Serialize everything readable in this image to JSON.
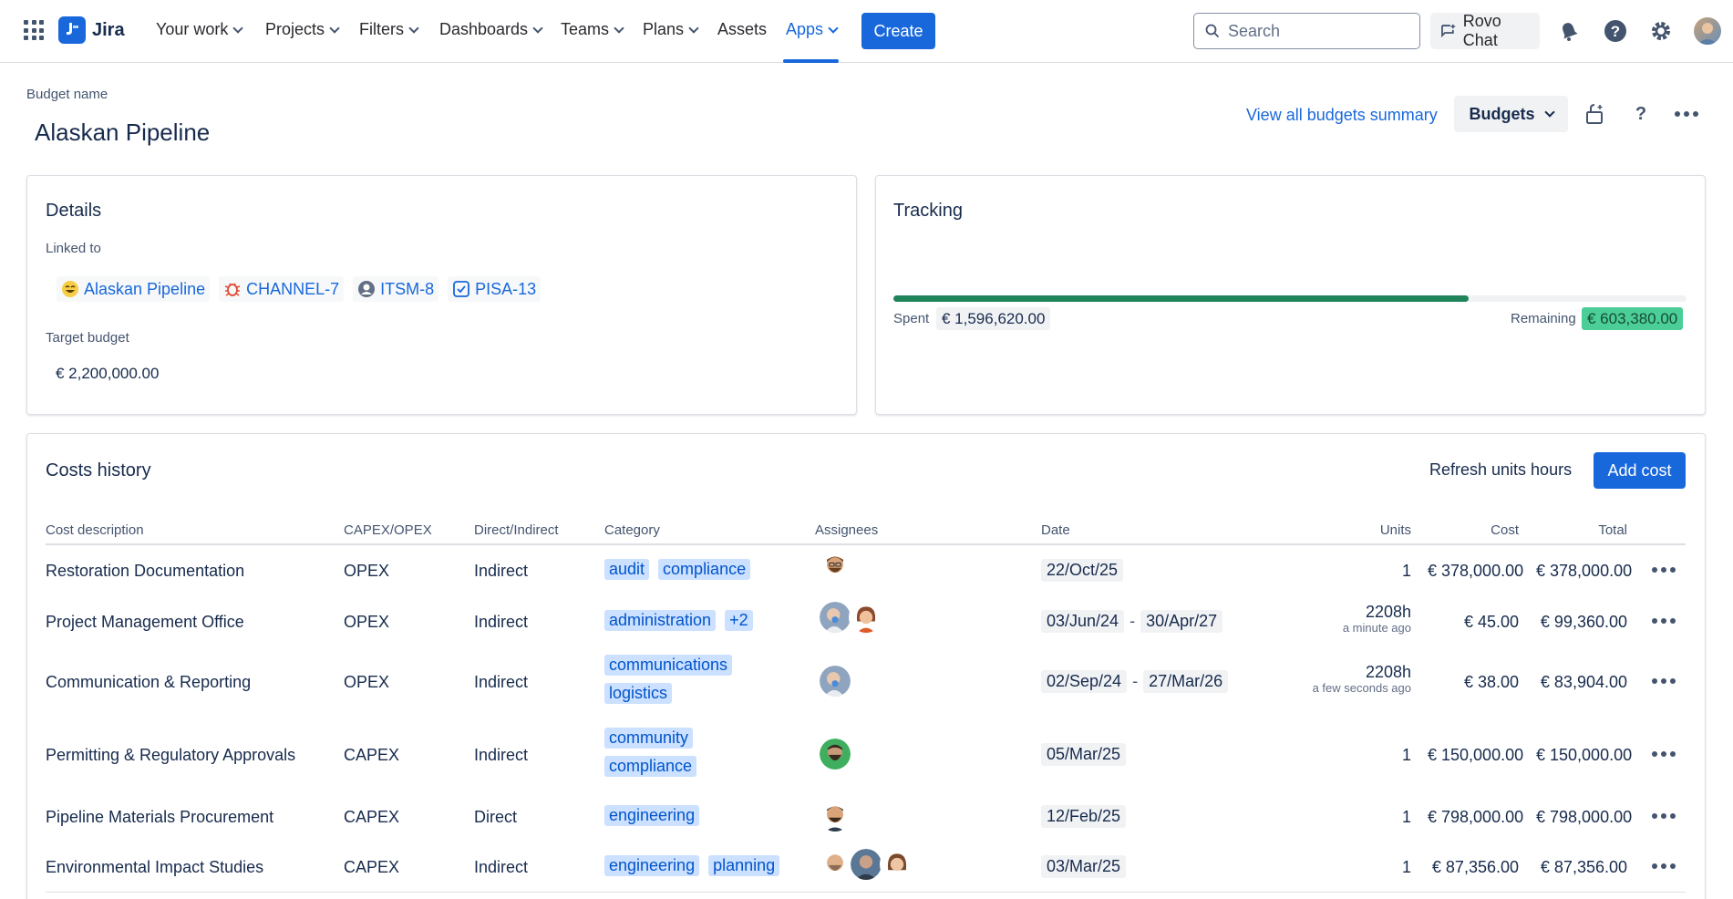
{
  "nav": {
    "logo": "Jira",
    "items": [
      "Your work",
      "Projects",
      "Filters",
      "Dashboards",
      "Teams",
      "Plans",
      "Assets",
      "Apps"
    ],
    "create": "Create",
    "search_placeholder": "Search",
    "rovo": "Rovo Chat",
    "accent": "#1868db"
  },
  "header": {
    "budget_label": "Budget name",
    "budget_name": "Alaskan Pipeline",
    "view_all": "View all budgets summary",
    "budgets_btn": "Budgets",
    "help": "?"
  },
  "details": {
    "title": "Details",
    "linked_label": "Linked to",
    "linked": [
      {
        "icon": "emoji-face-icon",
        "label": "Alaskan Pipeline"
      },
      {
        "icon": "bug-icon",
        "label": "CHANNEL-7"
      },
      {
        "icon": "person-icon",
        "label": "ITSM-8"
      },
      {
        "icon": "checkbox-icon",
        "label": "PISA-13"
      }
    ],
    "target_label": "Target budget",
    "target_value": "€  2,200,000.00"
  },
  "tracking": {
    "title": "Tracking",
    "spent_label": "Spent",
    "spent_value": "€ 1,596,620.00",
    "remaining_label": "Remaining",
    "remaining_value": "€ 603,380.00",
    "spent_fraction": 0.7257
  },
  "costs": {
    "title": "Costs history",
    "refresh": "Refresh units hours",
    "add": "Add cost",
    "headers": {
      "desc": "Cost description",
      "capex": "CAPEX/OPEX",
      "direct": "Direct/Indirect",
      "category": "Category",
      "assignees": "Assignees",
      "date": "Date",
      "units": "Units",
      "cost": "Cost",
      "total": "Total"
    },
    "rows": [
      {
        "desc": "Restoration Documentation",
        "capex": "OPEX",
        "direct": "Indirect",
        "tags": [
          "audit",
          "compliance"
        ],
        "dates": [
          "22/Oct/25"
        ],
        "units": "1",
        "units_sub": "",
        "cost": "€ 378,000.00",
        "total": "€ 378,000.00"
      },
      {
        "desc": "Project Management Office",
        "capex": "OPEX",
        "direct": "Indirect",
        "tags": [
          "administration",
          "+2"
        ],
        "dates": [
          "03/Jun/24",
          "30/Apr/27"
        ],
        "units": "2208h",
        "units_sub": "a minute ago",
        "cost": "€ 45.00",
        "total": "€ 99,360.00"
      },
      {
        "desc": "Communication & Reporting",
        "capex": "OPEX",
        "direct": "Indirect",
        "tags": [
          "communications",
          "logistics"
        ],
        "dates": [
          "02/Sep/24",
          "27/Mar/26"
        ],
        "units": "2208h",
        "units_sub": "a few seconds ago",
        "cost": "€ 38.00",
        "total": "€ 83,904.00"
      },
      {
        "desc": "Permitting & Regulatory Approvals",
        "capex": "CAPEX",
        "direct": "Indirect",
        "tags": [
          "community",
          "compliance"
        ],
        "dates": [
          "05/Mar/25"
        ],
        "units": "1",
        "units_sub": "",
        "cost": "€ 150,000.00",
        "total": "€ 150,000.00"
      },
      {
        "desc": "Pipeline Materials Procurement",
        "capex": "CAPEX",
        "direct": "Direct",
        "tags": [
          "engineering"
        ],
        "dates": [
          "12/Feb/25"
        ],
        "units": "1",
        "units_sub": "",
        "cost": "€ 798,000.00",
        "total": "€ 798,000.00"
      },
      {
        "desc": "Environmental Impact Studies",
        "capex": "CAPEX",
        "direct": "Indirect",
        "tags": [
          "engineering",
          "planning"
        ],
        "dates": [
          "03/Mar/25"
        ],
        "units": "1",
        "units_sub": "",
        "cost": "€ 87,356.00",
        "total": "€ 87,356.00"
      }
    ]
  }
}
